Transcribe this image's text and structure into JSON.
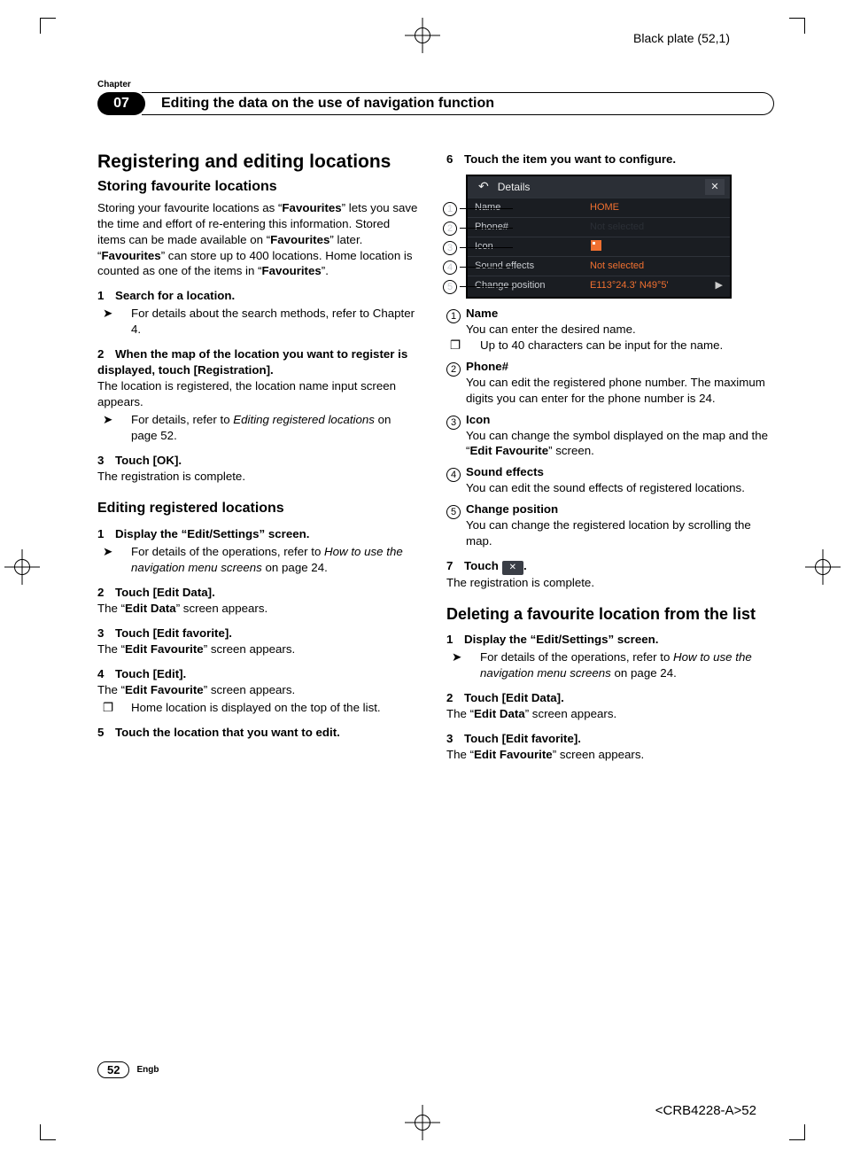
{
  "plate_label": "Black plate (52,1)",
  "chapter_label": "Chapter",
  "chapter_number": "07",
  "chapter_title": "Editing the data on the use of navigation function",
  "left": {
    "h2": "Registering and editing locations",
    "h3a": "Storing favourite locations",
    "intro_parts": {
      "a": "Storing your favourite locations as “",
      "favourites1": "Favourites",
      "b": "” lets you save the time and effort of re-entering this information. Stored items can be made available on “",
      "favourites2": "Favourites",
      "c": "” later.",
      "d": "“",
      "favourites3": "Favourites",
      "e": "” can store up to 400 locations. Home location is counted as one of the items in “",
      "favourites4": "Favourites",
      "f": "”."
    },
    "steps_a": [
      {
        "num": "1",
        "title": "Search for a location.",
        "bullet_prefix": "➤",
        "bullet": "For details about the search methods, refer to Chapter 4."
      },
      {
        "num": "2",
        "title": "When the map of the location you want to register is displayed, touch [Registration].",
        "after": "The location is registered, the location name input screen appears.",
        "bullet_prefix": "➤",
        "bullet_pre": "For details, refer to ",
        "bullet_em": "Editing registered locations",
        "bullet_post": " on page 52."
      },
      {
        "num": "3",
        "title": "Touch [OK].",
        "after": "The registration is complete."
      }
    ],
    "h3b": "Editing registered locations",
    "steps_b": [
      {
        "num": "1",
        "title": "Display the “Edit/Settings” screen.",
        "bullet_prefix": "➤",
        "bullet_pre": "For details of the operations, refer to ",
        "bullet_em": "How to use the navigation menu screens",
        "bullet_post": " on page 24."
      },
      {
        "num": "2",
        "title": "Touch [Edit Data].",
        "after_pre": "The “",
        "after_b": "Edit Data",
        "after_post": "” screen appears."
      },
      {
        "num": "3",
        "title": "Touch [Edit favorite].",
        "after_pre": "The “",
        "after_b": "Edit Favourite",
        "after_post": "” screen appears."
      },
      {
        "num": "4",
        "title": "Touch [Edit].",
        "after_pre": "The “",
        "after_b": "Edit Favourite",
        "after_post": "” screen appears.",
        "note_prefix": "❐",
        "note": "Home location is displayed on the top of the list."
      },
      {
        "num": "5",
        "title": "Touch the location that you want to edit."
      }
    ]
  },
  "right": {
    "step6": {
      "num": "6",
      "title": "Touch the item you want to configure."
    },
    "screenshot": {
      "title": "Details",
      "rows": [
        {
          "k": "Name",
          "v": "HOME"
        },
        {
          "k": "Phone#",
          "v": "Not selected"
        },
        {
          "k": "Icon",
          "v": ""
        },
        {
          "k": "Sound effects",
          "v": "Not selected"
        },
        {
          "k": "Change position",
          "v": "E113°24.3' N49°5'"
        }
      ],
      "callouts": [
        "1",
        "2",
        "3",
        "4",
        "5"
      ]
    },
    "items": [
      {
        "n": "1",
        "t": "Name",
        "d": "You can enter the desired name.",
        "note_prefix": "❐",
        "note": "Up to 40 characters can be input for the name."
      },
      {
        "n": "2",
        "t": "Phone#",
        "d": "You can edit the registered phone number. The maximum digits you can enter for the phone number is 24."
      },
      {
        "n": "3",
        "t": "Icon",
        "d_pre": "You can change the symbol displayed on the map and the “",
        "d_b": "Edit Favourite",
        "d_post": "” screen."
      },
      {
        "n": "4",
        "t": "Sound effects",
        "d": "You can edit the sound effects of registered locations."
      },
      {
        "n": "5",
        "t": "Change position",
        "d": "You can change the registered location by scrolling the map."
      }
    ],
    "step7": {
      "num": "7",
      "title_pre": "Touch ",
      "chip": "✕",
      "title_post": ".",
      "after": "The registration is complete."
    },
    "h3c": "Deleting a favourite location from the list",
    "steps_c": [
      {
        "num": "1",
        "title": "Display the “Edit/Settings” screen.",
        "bullet_prefix": "➤",
        "bullet_pre": "For details of the operations, refer to ",
        "bullet_em": "How to use the navigation menu screens",
        "bullet_post": " on page 24."
      },
      {
        "num": "2",
        "title": "Touch [Edit Data].",
        "after_pre": "The “",
        "after_b": "Edit Data",
        "after_post": "” screen appears."
      },
      {
        "num": "3",
        "title": "Touch [Edit favorite].",
        "after_pre": "The “",
        "after_b": "Edit Favourite",
        "after_post": "” screen appears."
      }
    ]
  },
  "footer": {
    "page": "52",
    "lang": "Engb",
    "doc_code": "<CRB4228-A>52"
  }
}
